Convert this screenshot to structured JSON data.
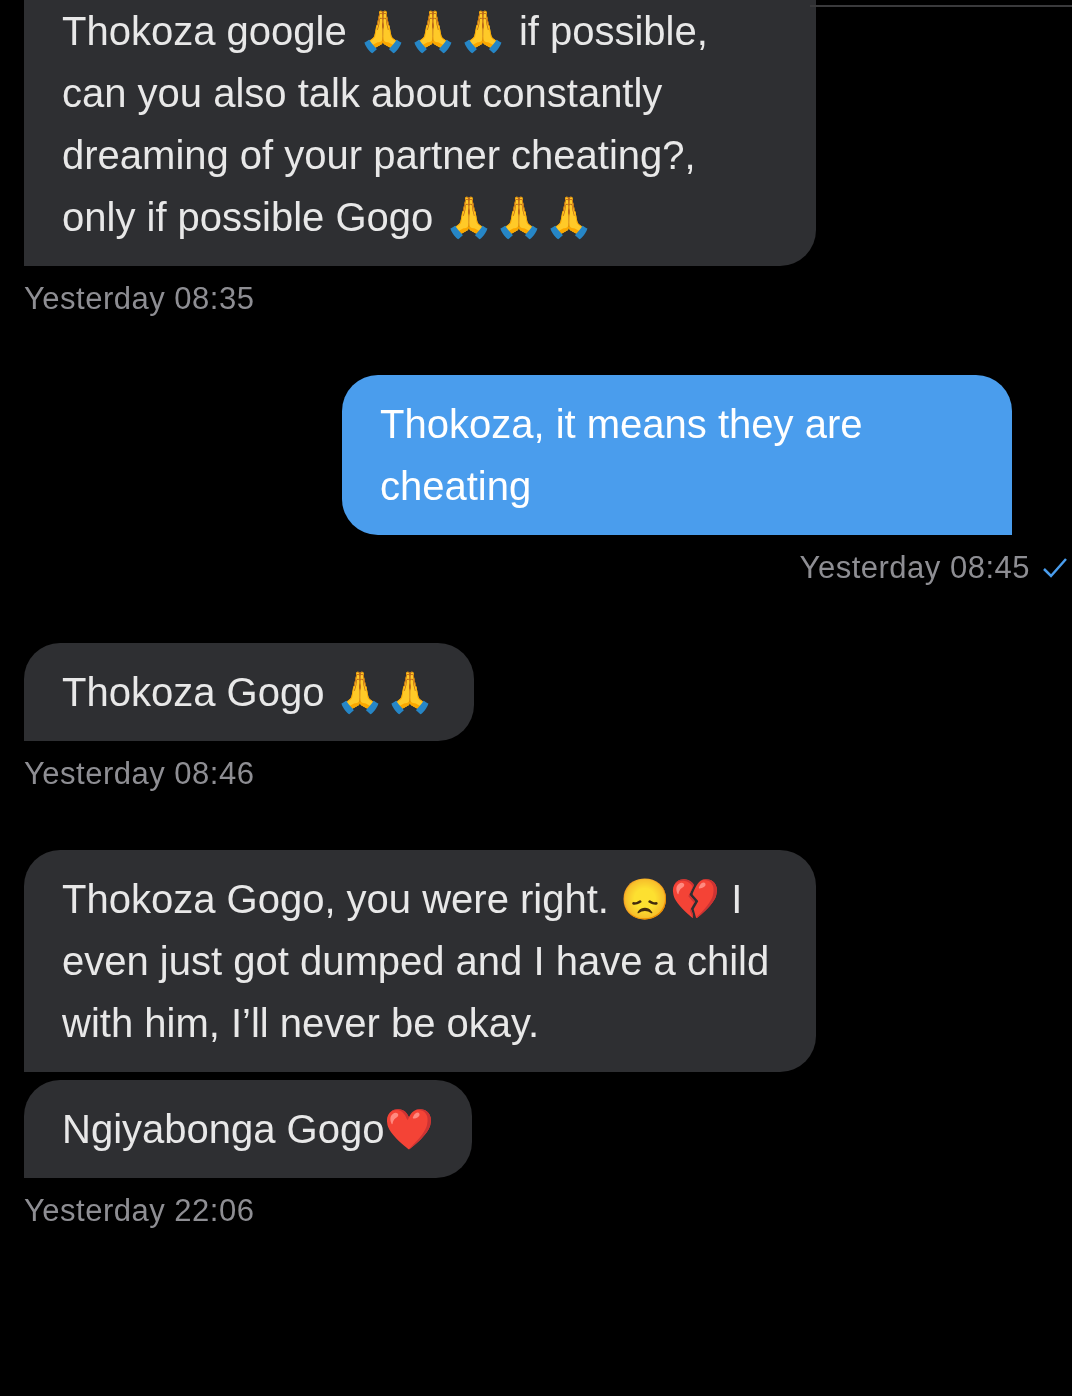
{
  "messages": [
    {
      "kind": "received",
      "bubbles": [
        "Thokoza google 🙏🙏🙏 if possible, can you also talk about constantly dreaming of your partner cheating?, only if possible Gogo 🙏🙏🙏"
      ],
      "time": "Yesterday 08:35"
    },
    {
      "kind": "sent",
      "bubbles": [
        "Thokoza, it means they are cheating"
      ],
      "time": "Yesterday 08:45",
      "read": true
    },
    {
      "kind": "received",
      "bubbles": [
        "Thokoza Gogo 🙏🙏"
      ],
      "time": "Yesterday 08:46"
    },
    {
      "kind": "received",
      "bubbles": [
        "Thokoza Gogo, you were right. 😞💔 I even just got dumped and I have a child with him, I’ll never be okay.",
        "Ngiyabonga Gogo❤️"
      ],
      "time": "Yesterday 22:06"
    }
  ]
}
